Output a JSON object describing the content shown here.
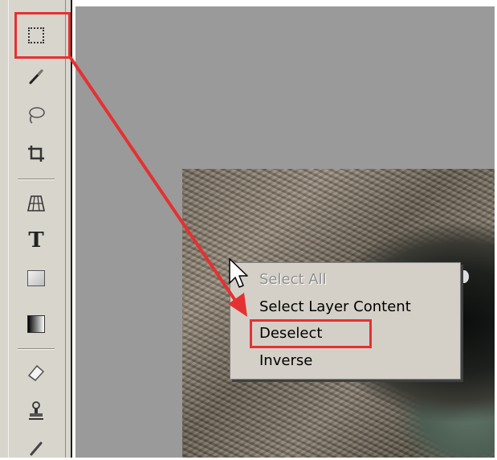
{
  "context_menu": {
    "items": [
      {
        "label": "Select All",
        "enabled": false
      },
      {
        "label": "Select Layer Content",
        "enabled": true
      },
      {
        "label": "Deselect",
        "enabled": true,
        "highlighted": true
      },
      {
        "label": "Inverse",
        "enabled": true
      }
    ]
  },
  "toolbar": {
    "tools": [
      {
        "icon": "rectangular-marquee-icon",
        "highlighted": true
      },
      {
        "icon": "brush-icon"
      },
      {
        "icon": "lasso-icon"
      },
      {
        "icon": "crop-icon"
      },
      {
        "icon": "perspective-grid-icon"
      },
      {
        "icon": "type-icon",
        "glyph": "T"
      },
      {
        "icon": "rectangle-shape-icon"
      },
      {
        "icon": "gradient-icon"
      },
      {
        "icon": "eraser-icon"
      },
      {
        "icon": "stamp-icon"
      },
      {
        "icon": "eyedropper-icon"
      }
    ]
  },
  "colors": {
    "annotation_red": "#e53131",
    "workspace_gray": "#9a9a9a",
    "menu_background": "#d4d0c8",
    "toolbar_background": "#d8d5cd"
  }
}
